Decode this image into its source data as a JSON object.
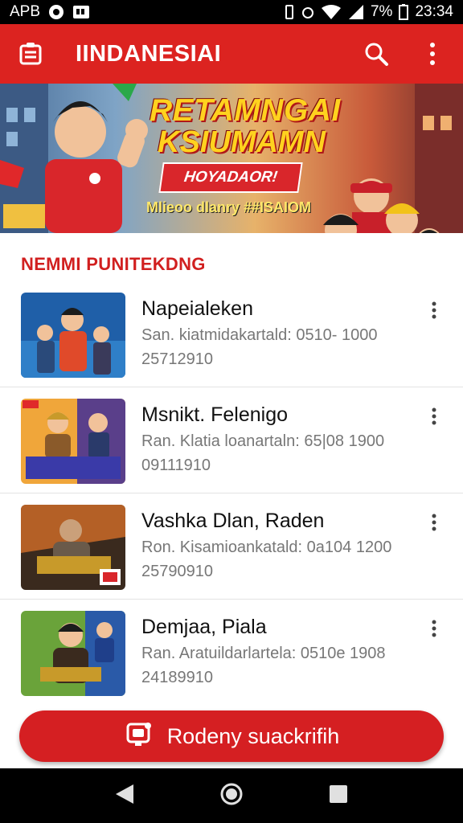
{
  "status_bar": {
    "carrier": "APB",
    "battery": "7%",
    "time": "23:34"
  },
  "app_bar": {
    "title": "IINDANESIAI"
  },
  "banner": {
    "headline_1": "RETAMNGAI",
    "headline_2": "KSIUMAMN",
    "ribbon": "HOYADAOR!",
    "subtitle": "Mlieoo dlanry ##ISAIOM"
  },
  "section": {
    "title": "NEMMI PUNITEKDNG"
  },
  "items": [
    {
      "name": "Napeialeken",
      "meta": "San. kiatmidakartald: 0510- 1000",
      "meta2": "25712910",
      "thumb_colors": [
        "#1f5fa8",
        "#e04a2a"
      ]
    },
    {
      "name": "Msnikt. Felenigo",
      "meta": "Ran. Klatia loanartaln: 65|08 1900",
      "meta2": "09111910",
      "thumb_colors": [
        "#f0a63a",
        "#5a3f8a"
      ]
    },
    {
      "name": "Vashka Dlan, Raden",
      "meta": "Ron. Kisamioankatald: 0a104 1200",
      "meta2": "25790910",
      "thumb_colors": [
        "#3a2a1e",
        "#e8772a"
      ]
    },
    {
      "name": "Demjaa, Piala",
      "meta": "Ran. Aratuildarlartela: 0510e 1908",
      "meta2": "24189910",
      "thumb_colors": [
        "#6aa33a",
        "#2a5aa8"
      ]
    }
  ],
  "cta": {
    "label": "Rodeny suackrifih"
  },
  "colors": {
    "primary": "#dc2320",
    "accent": "#ffd21f"
  }
}
